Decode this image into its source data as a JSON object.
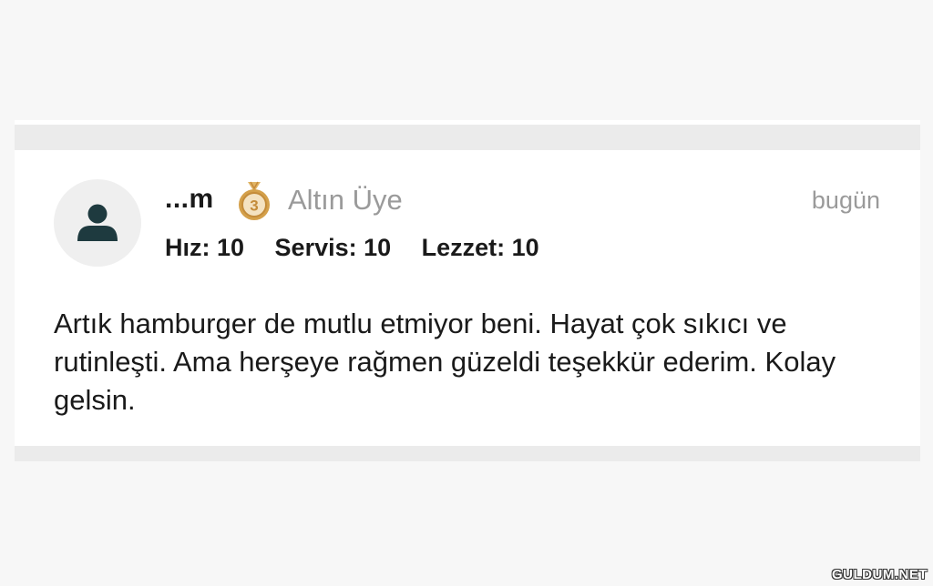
{
  "review": {
    "username": "...m",
    "medal_icon": "bronze-medal-3-icon",
    "medal_number": "3",
    "tier": "Altın Üye",
    "date": "bugün",
    "ratings": [
      {
        "label": "Hız",
        "value": "10",
        "text": "Hız: 10"
      },
      {
        "label": "Servis",
        "value": "10",
        "text": "Servis: 10"
      },
      {
        "label": "Lezzet",
        "value": "10",
        "text": "Lezzet: 10"
      }
    ],
    "text": "Artık hamburger de mutlu etmiyor beni. Hayat çok sıkıcı ve rutinleşti. Ama herşeye rağmen güzeldi teşekkür ederim. Kolay gelsin."
  },
  "watermark": "GULDUM.NET",
  "colors": {
    "background": "#f7f7f7",
    "card": "#ffffff",
    "divider": "#ebebeb",
    "muted_text": "#9a9a9a",
    "primary_text": "#1a1a1a",
    "avatar_icon": "#1e3a3f",
    "medal": "#d4a04a"
  }
}
